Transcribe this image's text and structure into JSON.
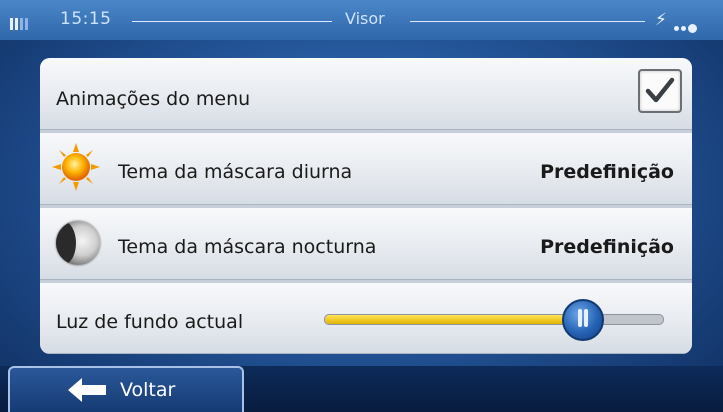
{
  "status_bar": {
    "time": "15:15",
    "title": "Visor",
    "gps_icon": "satellite-icon"
  },
  "settings": {
    "menu_animations": {
      "label": "Animações do menu",
      "checked": true
    },
    "day_theme": {
      "label": "Tema da máscara diurna",
      "value": "Predefinição",
      "icon": "sun-icon"
    },
    "night_theme": {
      "label": "Tema da máscara nocturna",
      "value": "Predefinição",
      "icon": "moon-icon"
    },
    "backlight": {
      "label": "Luz de fundo actual",
      "level": 0.76
    }
  },
  "bottom_bar": {
    "back_label": "Voltar"
  },
  "colors": {
    "accent_blue": "#2662b4",
    "slider_fill": "#f0c400",
    "status_bar": "#3a75b8"
  }
}
